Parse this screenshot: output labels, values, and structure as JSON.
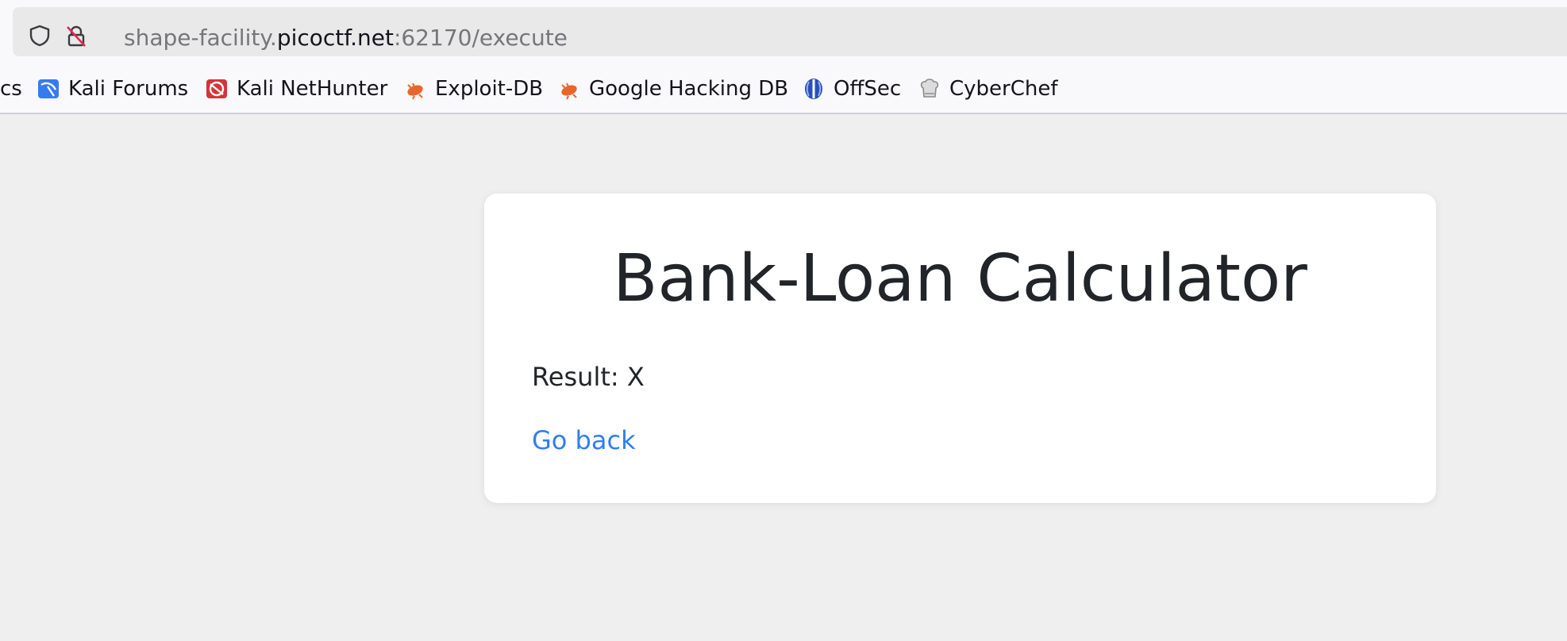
{
  "browser": {
    "url_prefix": "shape-facility.",
    "url_host": "picoctf.net",
    "url_suffix": ":62170/execute"
  },
  "bookmarks": [
    {
      "label": "cs",
      "icon": "truncated"
    },
    {
      "label": "Kali Forums",
      "icon": "kali-forums-icon"
    },
    {
      "label": "Kali NetHunter",
      "icon": "kali-nethunter-icon"
    },
    {
      "label": "Exploit-DB",
      "icon": "exploit-db-icon"
    },
    {
      "label": "Google Hacking DB",
      "icon": "google-hacking-db-icon"
    },
    {
      "label": "OffSec",
      "icon": "offsec-icon"
    },
    {
      "label": "CyberChef",
      "icon": "cyberchef-icon"
    }
  ],
  "page": {
    "title": "Bank-Loan Calculator",
    "result_text": "Result: X",
    "go_back_label": "Go back"
  },
  "colors": {
    "link": "#2f7ef5",
    "text": "#212529",
    "background": "#efefef",
    "card": "#ffffff"
  }
}
